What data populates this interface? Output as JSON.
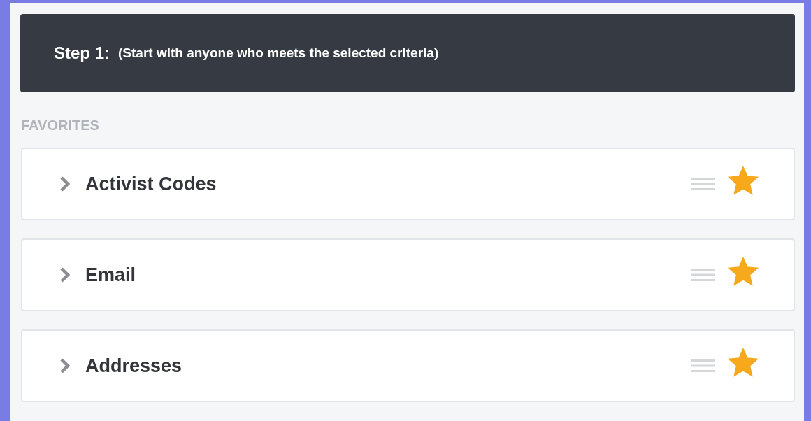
{
  "header": {
    "step": "Step 1:",
    "description": "(Start with anyone who meets the selected criteria)"
  },
  "section_label": "FAVORITES",
  "items": [
    {
      "label": "Activist Codes",
      "expanded": false,
      "favorite": true
    },
    {
      "label": "Email",
      "expanded": false,
      "favorite": true
    },
    {
      "label": "Addresses",
      "expanded": false,
      "favorite": true
    }
  ]
}
